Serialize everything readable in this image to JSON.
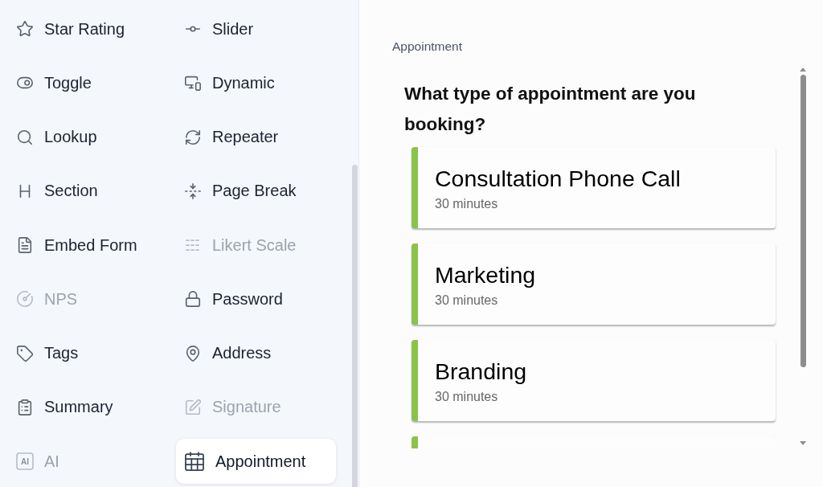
{
  "sidebar": {
    "items": [
      {
        "label": "Star Rating",
        "disabled": false,
        "selected": false
      },
      {
        "label": "Slider",
        "disabled": false,
        "selected": false
      },
      {
        "label": "Toggle",
        "disabled": false,
        "selected": false
      },
      {
        "label": "Dynamic",
        "disabled": false,
        "selected": false
      },
      {
        "label": "Lookup",
        "disabled": false,
        "selected": false
      },
      {
        "label": "Repeater",
        "disabled": false,
        "selected": false
      },
      {
        "label": "Section",
        "disabled": false,
        "selected": false
      },
      {
        "label": "Page Break",
        "disabled": false,
        "selected": false
      },
      {
        "label": "Embed Form",
        "disabled": false,
        "selected": false
      },
      {
        "label": "Likert Scale",
        "disabled": true,
        "selected": false
      },
      {
        "label": "NPS",
        "disabled": true,
        "selected": false
      },
      {
        "label": "Password",
        "disabled": false,
        "selected": false
      },
      {
        "label": "Tags",
        "disabled": false,
        "selected": false
      },
      {
        "label": "Address",
        "disabled": false,
        "selected": false
      },
      {
        "label": "Summary",
        "disabled": false,
        "selected": false
      },
      {
        "label": "Signature",
        "disabled": true,
        "selected": false
      },
      {
        "label": "AI",
        "icon_text": "AI",
        "disabled": true,
        "selected": false
      },
      {
        "label": "Appointment",
        "disabled": false,
        "selected": true
      }
    ]
  },
  "panel": {
    "title": "Appointment",
    "question": "What type of appointment are you booking?",
    "options": [
      {
        "name": "Consultation Phone Call",
        "duration": "30 minutes"
      },
      {
        "name": "Marketing",
        "duration": "30 minutes"
      },
      {
        "name": "Branding",
        "duration": "30 minutes"
      }
    ],
    "more_below": true
  }
}
